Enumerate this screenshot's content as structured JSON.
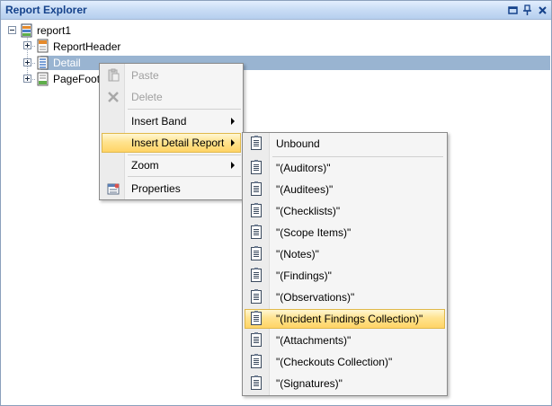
{
  "panel": {
    "title": "Report Explorer"
  },
  "tree": {
    "root": "report1",
    "children": [
      "ReportHeader",
      "Detail",
      "PageFooter"
    ]
  },
  "context_menu": {
    "items": [
      {
        "label": "Paste",
        "enabled": false,
        "icon": "paste-icon"
      },
      {
        "label": "Delete",
        "enabled": false,
        "icon": "delete-icon"
      },
      {
        "label": "Insert Band",
        "submenu": true
      },
      {
        "label": "Insert Detail Report",
        "submenu": true,
        "highlighted": true
      },
      {
        "label": "Zoom",
        "submenu": true
      },
      {
        "label": "Properties",
        "icon": "properties-icon"
      }
    ]
  },
  "submenu": {
    "items": [
      "Unbound",
      "\"(Auditors)\"",
      "\"(Auditees)\"",
      "\"(Checklists)\"",
      "\"(Scope Items)\"",
      "\"(Notes)\"",
      "\"(Findings)\"",
      "\"(Observations)\"",
      "\"(Incident Findings Collection)\"",
      "\"(Attachments)\"",
      "\"(Checkouts Collection)\"",
      "\"(Signatures)\""
    ],
    "highlighted_index": 8
  },
  "colors": {
    "selection": "#99b4d1",
    "menu_highlight": "#ffe38f",
    "title_text": "#15428b"
  }
}
